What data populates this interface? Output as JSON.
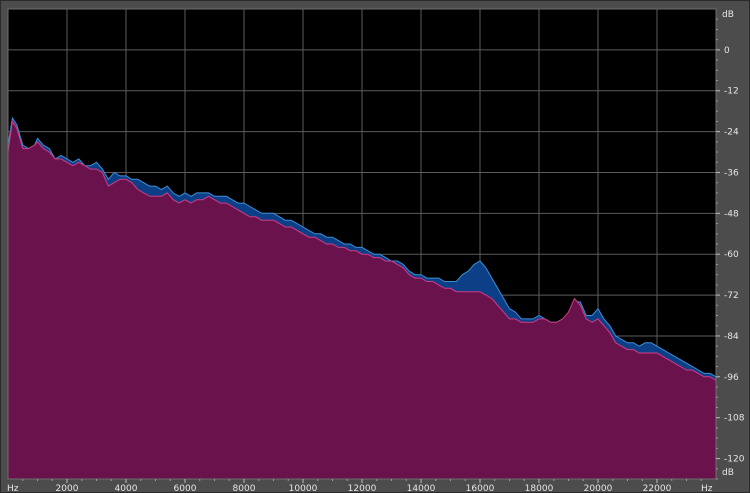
{
  "chart_data": {
    "type": "area",
    "title": "",
    "xlabel": "",
    "ylabel": "",
    "x_unit_label": "Hz",
    "y_unit_label": "dB",
    "xlim": [
      0,
      24000
    ],
    "ylim": [
      -126,
      12
    ],
    "x_ticks": [
      2000,
      4000,
      6000,
      8000,
      10000,
      12000,
      14000,
      16000,
      18000,
      20000,
      22000
    ],
    "y_ticks": [
      0,
      -12,
      -24,
      -36,
      -48,
      -60,
      -72,
      -84,
      -96,
      -108,
      -120
    ],
    "grid": true,
    "legend": "none",
    "series": [
      {
        "color": "#0c3f86",
        "edge_color": "#3d8fd9",
        "points": [
          [
            0,
            -28
          ],
          [
            150,
            -20
          ],
          [
            300,
            -22
          ],
          [
            500,
            -28
          ],
          [
            700,
            -29
          ],
          [
            900,
            -28
          ],
          [
            1000,
            -26
          ],
          [
            1200,
            -28
          ],
          [
            1400,
            -29
          ],
          [
            1600,
            -32
          ],
          [
            1800,
            -31
          ],
          [
            2000,
            -32
          ],
          [
            2200,
            -33
          ],
          [
            2400,
            -32
          ],
          [
            2600,
            -34
          ],
          [
            2800,
            -34
          ],
          [
            3000,
            -33
          ],
          [
            3200,
            -35
          ],
          [
            3400,
            -38
          ],
          [
            3600,
            -36
          ],
          [
            3800,
            -37
          ],
          [
            4000,
            -37
          ],
          [
            4200,
            -38
          ],
          [
            4400,
            -38
          ],
          [
            4600,
            -39
          ],
          [
            4800,
            -40
          ],
          [
            5000,
            -40
          ],
          [
            5200,
            -41
          ],
          [
            5400,
            -40
          ],
          [
            5600,
            -42
          ],
          [
            5800,
            -43
          ],
          [
            6000,
            -42
          ],
          [
            6200,
            -43
          ],
          [
            6400,
            -42
          ],
          [
            6600,
            -42
          ],
          [
            6800,
            -42
          ],
          [
            7000,
            -43
          ],
          [
            7200,
            -43
          ],
          [
            7400,
            -43
          ],
          [
            7600,
            -44
          ],
          [
            7800,
            -45
          ],
          [
            8000,
            -45
          ],
          [
            8200,
            -46
          ],
          [
            8400,
            -47
          ],
          [
            8600,
            -48
          ],
          [
            8800,
            -48
          ],
          [
            9000,
            -48
          ],
          [
            9200,
            -49
          ],
          [
            9400,
            -50
          ],
          [
            9600,
            -50
          ],
          [
            9800,
            -51
          ],
          [
            10000,
            -52
          ],
          [
            10200,
            -53
          ],
          [
            10400,
            -54
          ],
          [
            10600,
            -54
          ],
          [
            10800,
            -55
          ],
          [
            11000,
            -55
          ],
          [
            11200,
            -56
          ],
          [
            11400,
            -57
          ],
          [
            11600,
            -57
          ],
          [
            11800,
            -58
          ],
          [
            12000,
            -58
          ],
          [
            12200,
            -59
          ],
          [
            12400,
            -60
          ],
          [
            12600,
            -60
          ],
          [
            12800,
            -61
          ],
          [
            13000,
            -62
          ],
          [
            13200,
            -62
          ],
          [
            13400,
            -63
          ],
          [
            13600,
            -65
          ],
          [
            13800,
            -66
          ],
          [
            14000,
            -66
          ],
          [
            14200,
            -67
          ],
          [
            14400,
            -67
          ],
          [
            14600,
            -67
          ],
          [
            14800,
            -68
          ],
          [
            15000,
            -68
          ],
          [
            15200,
            -68
          ],
          [
            15400,
            -66
          ],
          [
            15600,
            -65
          ],
          [
            15800,
            -63
          ],
          [
            16000,
            -62
          ],
          [
            16200,
            -64
          ],
          [
            16400,
            -67
          ],
          [
            16600,
            -70
          ],
          [
            16800,
            -73
          ],
          [
            17000,
            -76
          ],
          [
            17200,
            -77
          ],
          [
            17400,
            -79
          ],
          [
            17600,
            -79
          ],
          [
            17800,
            -79
          ],
          [
            18000,
            -78
          ],
          [
            18200,
            -79
          ],
          [
            18400,
            -80
          ],
          [
            18600,
            -80
          ],
          [
            18800,
            -79
          ],
          [
            19000,
            -78
          ],
          [
            19200,
            -74
          ],
          [
            19400,
            -74
          ],
          [
            19600,
            -78
          ],
          [
            19800,
            -78
          ],
          [
            20000,
            -76
          ],
          [
            20200,
            -79
          ],
          [
            20400,
            -81
          ],
          [
            20600,
            -84
          ],
          [
            20800,
            -85
          ],
          [
            21000,
            -86
          ],
          [
            21200,
            -86
          ],
          [
            21400,
            -87
          ],
          [
            21600,
            -86
          ],
          [
            21800,
            -86
          ],
          [
            22000,
            -87
          ],
          [
            22200,
            -88
          ],
          [
            22400,
            -89
          ],
          [
            22600,
            -90
          ],
          [
            22800,
            -91
          ],
          [
            23000,
            -92
          ],
          [
            23200,
            -93
          ],
          [
            23400,
            -94
          ],
          [
            23600,
            -95
          ],
          [
            23800,
            -95
          ],
          [
            24000,
            -96
          ]
        ]
      },
      {
        "color": "#6a124c",
        "edge_color": "#cf3c86",
        "points": [
          [
            0,
            -30
          ],
          [
            150,
            -21
          ],
          [
            300,
            -23
          ],
          [
            500,
            -29
          ],
          [
            700,
            -29
          ],
          [
            900,
            -28
          ],
          [
            1000,
            -27
          ],
          [
            1200,
            -29
          ],
          [
            1400,
            -30
          ],
          [
            1600,
            -32
          ],
          [
            1800,
            -32
          ],
          [
            2000,
            -33
          ],
          [
            2200,
            -34
          ],
          [
            2400,
            -33
          ],
          [
            2600,
            -34
          ],
          [
            2800,
            -35
          ],
          [
            3000,
            -35
          ],
          [
            3200,
            -36
          ],
          [
            3400,
            -40
          ],
          [
            3600,
            -39
          ],
          [
            3800,
            -38
          ],
          [
            4000,
            -38
          ],
          [
            4200,
            -39
          ],
          [
            4400,
            -41
          ],
          [
            4600,
            -42
          ],
          [
            4800,
            -43
          ],
          [
            5000,
            -43
          ],
          [
            5200,
            -43
          ],
          [
            5400,
            -42
          ],
          [
            5600,
            -44
          ],
          [
            5800,
            -45
          ],
          [
            6000,
            -44
          ],
          [
            6200,
            -45
          ],
          [
            6400,
            -44
          ],
          [
            6600,
            -44
          ],
          [
            6800,
            -43
          ],
          [
            7000,
            -44
          ],
          [
            7200,
            -45
          ],
          [
            7400,
            -45
          ],
          [
            7600,
            -46
          ],
          [
            7800,
            -47
          ],
          [
            8000,
            -48
          ],
          [
            8200,
            -49
          ],
          [
            8400,
            -49
          ],
          [
            8600,
            -50
          ],
          [
            8800,
            -50
          ],
          [
            9000,
            -50
          ],
          [
            9200,
            -51
          ],
          [
            9400,
            -52
          ],
          [
            9600,
            -52
          ],
          [
            9800,
            -53
          ],
          [
            10000,
            -54
          ],
          [
            10200,
            -55
          ],
          [
            10400,
            -55
          ],
          [
            10600,
            -56
          ],
          [
            10800,
            -57
          ],
          [
            11000,
            -57
          ],
          [
            11200,
            -58
          ],
          [
            11400,
            -58
          ],
          [
            11600,
            -59
          ],
          [
            11800,
            -59
          ],
          [
            12000,
            -60
          ],
          [
            12200,
            -60
          ],
          [
            12400,
            -61
          ],
          [
            12600,
            -61
          ],
          [
            12800,
            -62
          ],
          [
            13000,
            -62
          ],
          [
            13200,
            -63
          ],
          [
            13400,
            -64
          ],
          [
            13600,
            -66
          ],
          [
            13800,
            -67
          ],
          [
            14000,
            -67
          ],
          [
            14200,
            -68
          ],
          [
            14400,
            -68
          ],
          [
            14600,
            -69
          ],
          [
            14800,
            -70
          ],
          [
            15000,
            -70
          ],
          [
            15200,
            -71
          ],
          [
            15400,
            -71
          ],
          [
            15600,
            -71
          ],
          [
            15800,
            -71
          ],
          [
            16000,
            -71
          ],
          [
            16200,
            -72
          ],
          [
            16400,
            -73
          ],
          [
            16600,
            -75
          ],
          [
            16800,
            -77
          ],
          [
            17000,
            -79
          ],
          [
            17200,
            -79
          ],
          [
            17400,
            -80
          ],
          [
            17600,
            -80
          ],
          [
            17800,
            -80
          ],
          [
            18000,
            -79
          ],
          [
            18200,
            -79
          ],
          [
            18400,
            -80
          ],
          [
            18600,
            -80
          ],
          [
            18800,
            -79
          ],
          [
            19000,
            -77
          ],
          [
            19200,
            -73
          ],
          [
            19400,
            -75
          ],
          [
            19600,
            -79
          ],
          [
            19800,
            -80
          ],
          [
            20000,
            -79
          ],
          [
            20200,
            -81
          ],
          [
            20400,
            -83
          ],
          [
            20600,
            -86
          ],
          [
            20800,
            -87
          ],
          [
            21000,
            -88
          ],
          [
            21200,
            -88
          ],
          [
            21400,
            -89
          ],
          [
            21600,
            -89
          ],
          [
            21800,
            -89
          ],
          [
            22000,
            -89
          ],
          [
            22200,
            -90
          ],
          [
            22400,
            -91
          ],
          [
            22600,
            -92
          ],
          [
            22800,
            -93
          ],
          [
            23000,
            -94
          ],
          [
            23200,
            -94
          ],
          [
            23400,
            -95
          ],
          [
            23600,
            -96
          ],
          [
            23800,
            -96
          ],
          [
            24000,
            -97
          ]
        ]
      }
    ]
  }
}
